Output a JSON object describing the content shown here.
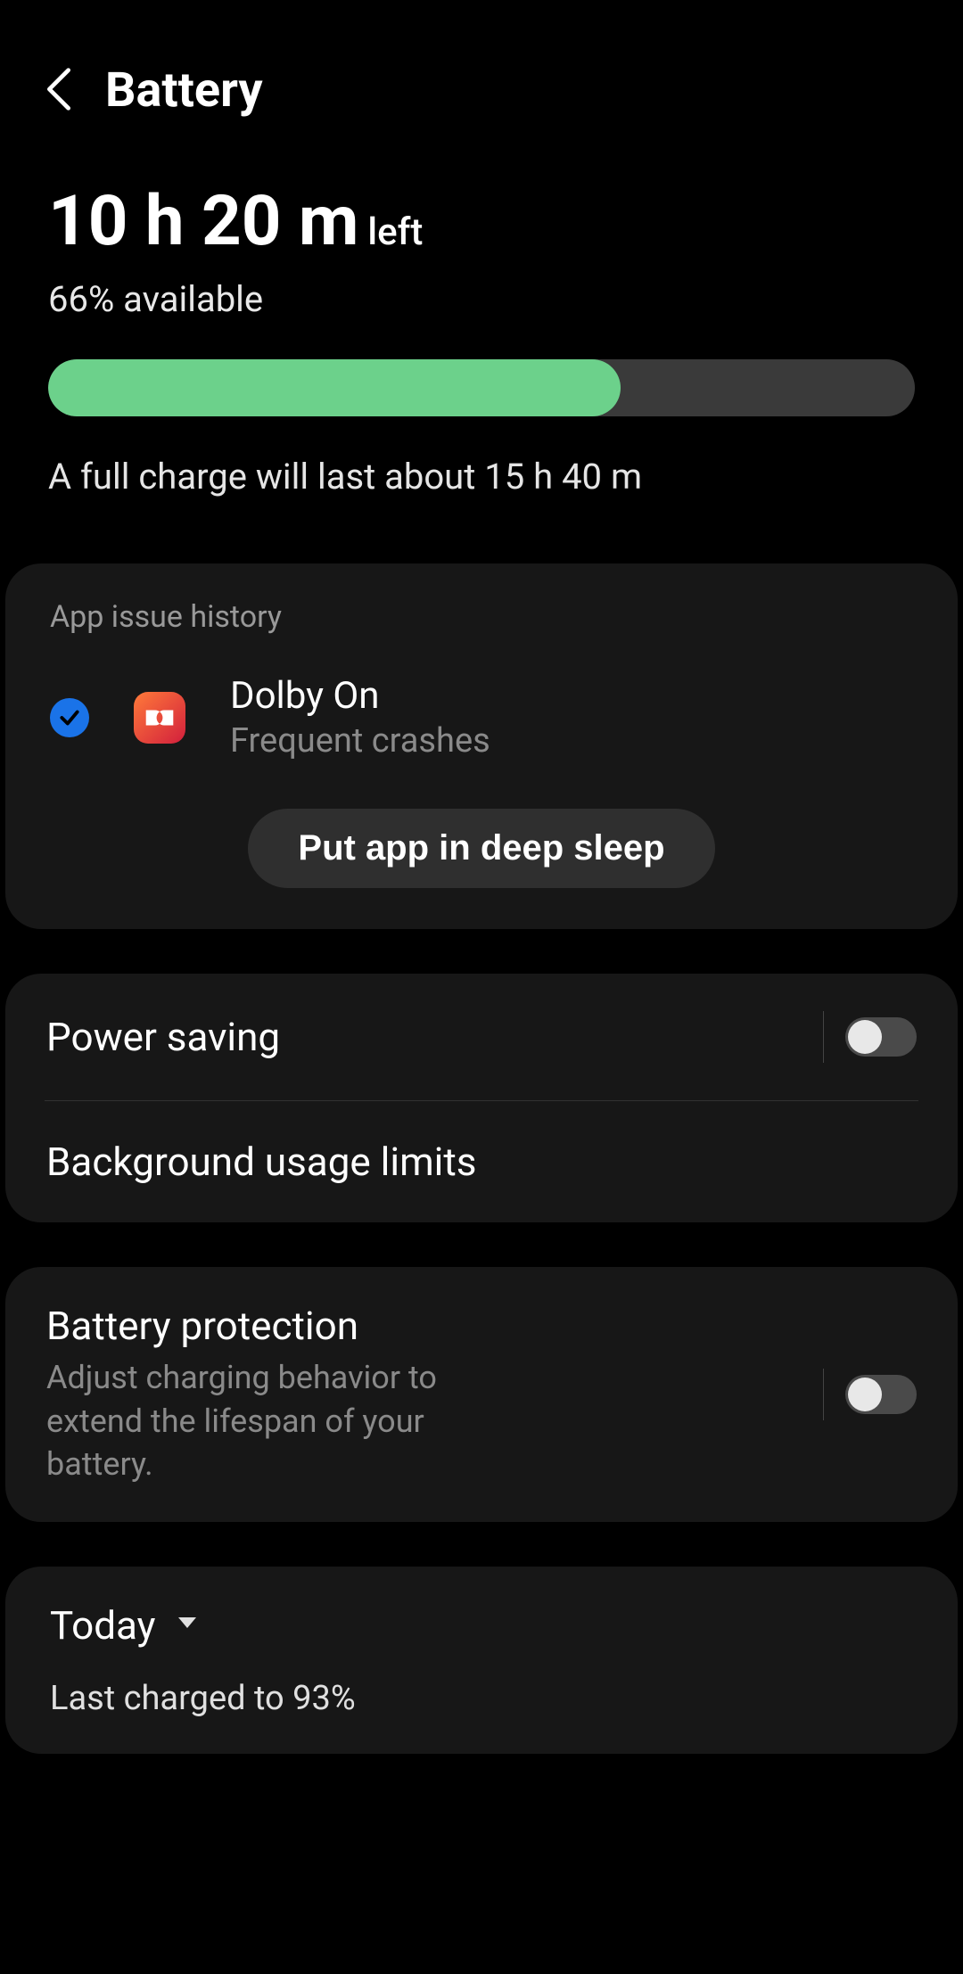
{
  "header": {
    "title": "Battery"
  },
  "summary": {
    "time_left_main": "10 h 20 m",
    "time_left_suffix": "left",
    "pct_available_text": "66% available",
    "battery_pct": 66,
    "full_charge_note": "A full charge will last about 15 h 40 m"
  },
  "issue": {
    "section_title": "App issue history",
    "app_name": "Dolby On",
    "app_sub": "Frequent crashes",
    "action_label": "Put app in deep sleep"
  },
  "settings": {
    "power_saving_label": "Power saving",
    "power_saving_on": false,
    "bg_limits_label": "Background usage limits"
  },
  "protection": {
    "label": "Battery protection",
    "sub": "Adjust charging behavior to extend the lifespan of your battery.",
    "on": false
  },
  "today": {
    "label": "Today",
    "last_charged": "Last charged to 93%"
  }
}
